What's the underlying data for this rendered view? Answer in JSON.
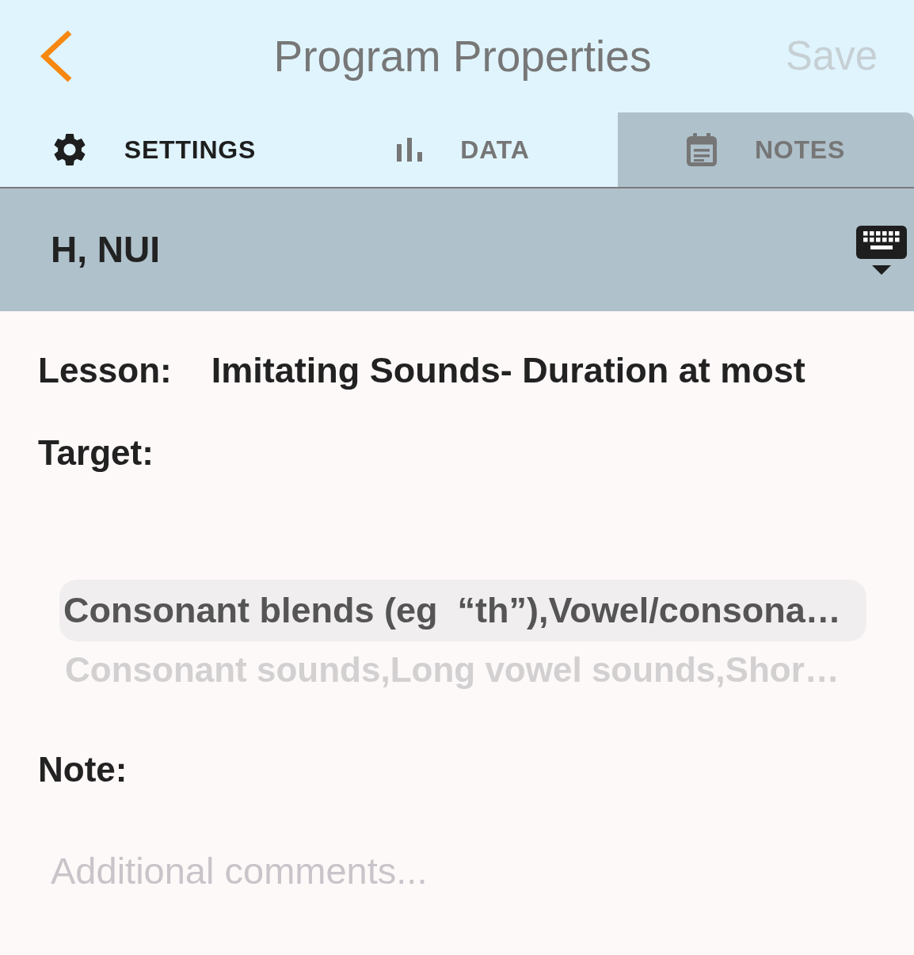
{
  "header": {
    "title": "Program Properties",
    "save_button": {
      "label": "Save",
      "disabled": true
    }
  },
  "tabs": [
    {
      "label": "SETTINGS",
      "selected": false,
      "emphasized": true
    },
    {
      "label": "DATA",
      "selected": false,
      "emphasized": false
    },
    {
      "label": "NOTES",
      "selected": true,
      "emphasized": false
    }
  ],
  "student_banner": {
    "name": "H, NUI"
  },
  "fields": [
    {
      "kind": "text",
      "label": "Lesson:",
      "value": "Imitating Sounds- Duration at most"
    },
    {
      "kind": "picker",
      "label": "Target:",
      "options": [
        {
          "label": "Consonant blends (eg  “th”),Vowel/consona…",
          "selected": true
        },
        {
          "label": "Consonant sounds,Long vowel sounds,Shor…",
          "selected": false
        }
      ]
    },
    {
      "kind": "textarea",
      "label": "Note:",
      "placeholder": "Additional comments..."
    }
  ]
}
